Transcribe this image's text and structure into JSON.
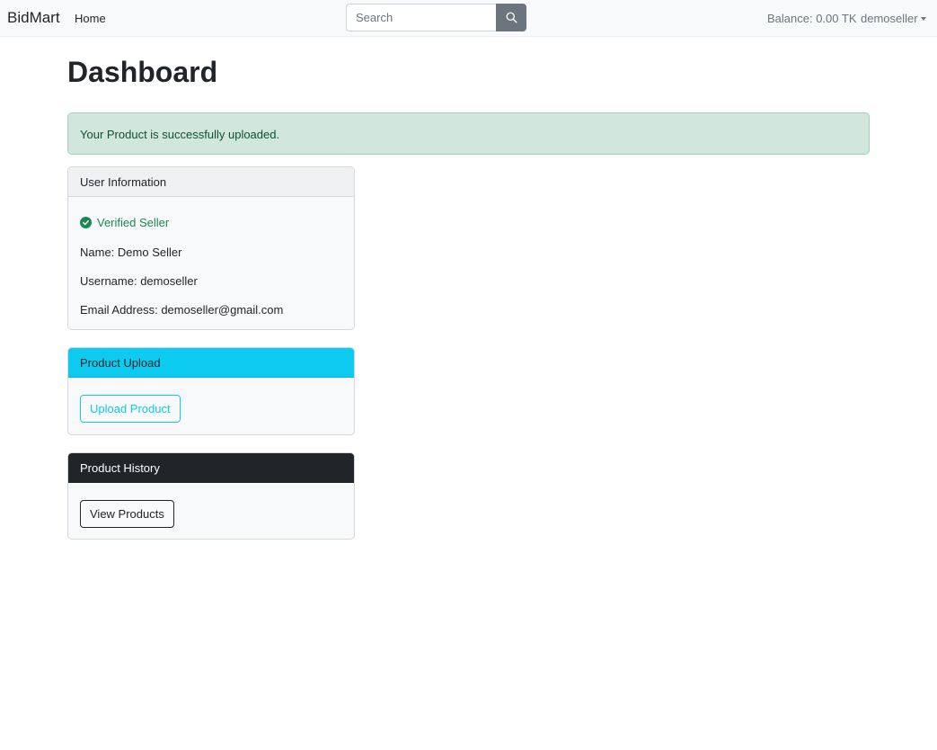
{
  "nav": {
    "brand": "BidMart",
    "home": "Home",
    "search_placeholder": "Search",
    "balance": "Balance: 0.00 TK",
    "username": "demoseller"
  },
  "page": {
    "title": "Dashboard"
  },
  "alert": {
    "message": "Your Product is successfully uploaded."
  },
  "user_card": {
    "header": "User Information",
    "verified": "Verified Seller",
    "name": "Name: Demo Seller",
    "username": "Username: demoseller",
    "email": "Email Address: demoseller@gmail.com"
  },
  "upload_card": {
    "header": "Product Upload",
    "button": "Upload Product"
  },
  "history_card": {
    "header": "Product History",
    "button": "View Products"
  },
  "colors": {
    "success": "#198754",
    "info": "#0dcaf0",
    "dark": "#212529",
    "secondary": "#6c757d"
  }
}
